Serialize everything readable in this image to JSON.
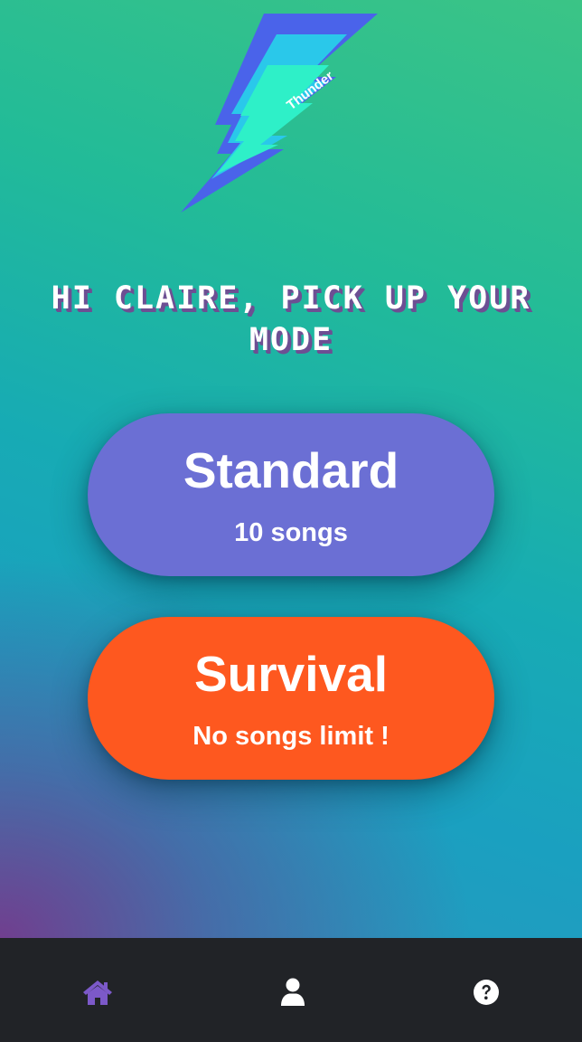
{
  "logo": {
    "text": "Thunder",
    "colors": {
      "outer": "#4a63ea",
      "middle": "#2ac8ea",
      "inner": "#2ef0c8"
    }
  },
  "greeting": {
    "text": "HI CLAIRE, PICK UP YOUR MODE"
  },
  "modes": [
    {
      "title": "Standard",
      "subtitle": "10 songs",
      "color": "#6b6fd4"
    },
    {
      "title": "Survival",
      "subtitle": "No songs limit !",
      "color": "#fe581f"
    }
  ],
  "tabbar": {
    "background": "#212327",
    "items": [
      {
        "icon": "home-icon",
        "active": true,
        "color": "#7c59c9"
      },
      {
        "icon": "user-icon",
        "active": false,
        "color": "#ffffff"
      },
      {
        "icon": "help-circle-icon",
        "active": false,
        "color": "#ffffff"
      }
    ]
  }
}
